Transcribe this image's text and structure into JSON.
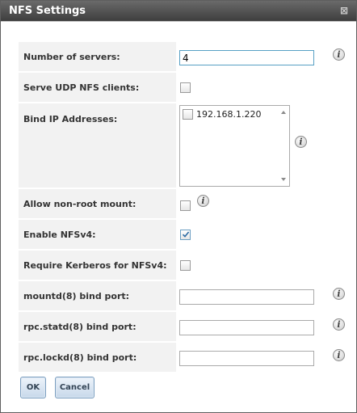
{
  "dialog": {
    "title": "NFS Settings",
    "close_glyph": "⊠"
  },
  "fields": {
    "num_servers": {
      "label": "Number of servers:",
      "value": "4"
    },
    "serve_udp": {
      "label": "Serve UDP NFS clients:",
      "checked": false
    },
    "bind_ip": {
      "label": "Bind IP Addresses:",
      "options": [
        {
          "label": "192.168.1.220",
          "checked": false
        }
      ]
    },
    "allow_nonroot": {
      "label": "Allow non-root mount:",
      "checked": false
    },
    "enable_nfsv4": {
      "label": "Enable NFSv4:",
      "checked": true
    },
    "require_kerberos": {
      "label": "Require Kerberos for NFSv4:",
      "checked": false
    },
    "mountd_port": {
      "label": "mountd(8) bind port:",
      "value": ""
    },
    "statd_port": {
      "label": "rpc.statd(8) bind port:",
      "value": ""
    },
    "lockd_port": {
      "label": "rpc.lockd(8) bind port:",
      "value": ""
    }
  },
  "buttons": {
    "ok": "OK",
    "cancel": "Cancel"
  },
  "icons": {
    "info": "i",
    "info_icon_name": "info-icon",
    "checkmark": "checkmark-icon"
  },
  "colors": {
    "titlebar": "#4a4a4a",
    "label_bg": "#f2f2f2",
    "button_border": "#7b9ec0"
  }
}
